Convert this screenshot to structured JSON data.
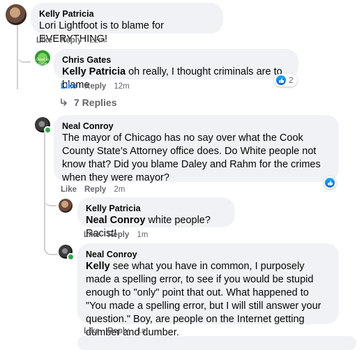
{
  "comments": [
    {
      "author": "Kelly Patricia",
      "text": "Lori Lightfoot is to blame for EVERYTHING!",
      "like": "Like",
      "reply": "Reply",
      "time": "22m"
    },
    {
      "author": "Chris Gates",
      "mention": "Kelly Patricia",
      "text": " oh really, I thought criminals are to blame",
      "like": "Like",
      "reply": "Reply",
      "time": "12m",
      "reaction_count": "2",
      "avatar_text": "Good to Great"
    },
    {
      "view_replies": "7 Replies"
    },
    {
      "author": "Neal Conroy",
      "text": "The mayor of Chicago has no say over what the Cook County State's Attorney office does. Do White people not know that? Did you blame Daley and Rahm for the crimes when they were mayor?",
      "like": "Like",
      "reply": "Reply",
      "time": "2m"
    },
    {
      "author": "Kelly Patricia",
      "mention": "Neal Conroy",
      "text": " white people? Racist!",
      "like": "Like",
      "reply": "Reply",
      "time": "1m"
    },
    {
      "author": "Neal Conroy",
      "mention": "Kelly",
      "text": " see what you have in common, I purposely made a spelling error, to see if you would be stupid enough to \"only\" point that out. What happened to \"You made a spelling error, but I will still answer your question.\" Boy, are people on the Internet getting dumber and dumber.",
      "like": "Like",
      "reply": "Reply",
      "time": "1m"
    }
  ],
  "icons": {
    "like_reaction": "like-reaction-icon",
    "reply_arrow": "reply-arrow-icon"
  },
  "colors": {
    "bubble": "#f0f2f5",
    "muted": "#65676b",
    "like_blue": "#1877f2",
    "online": "#31a24c"
  }
}
